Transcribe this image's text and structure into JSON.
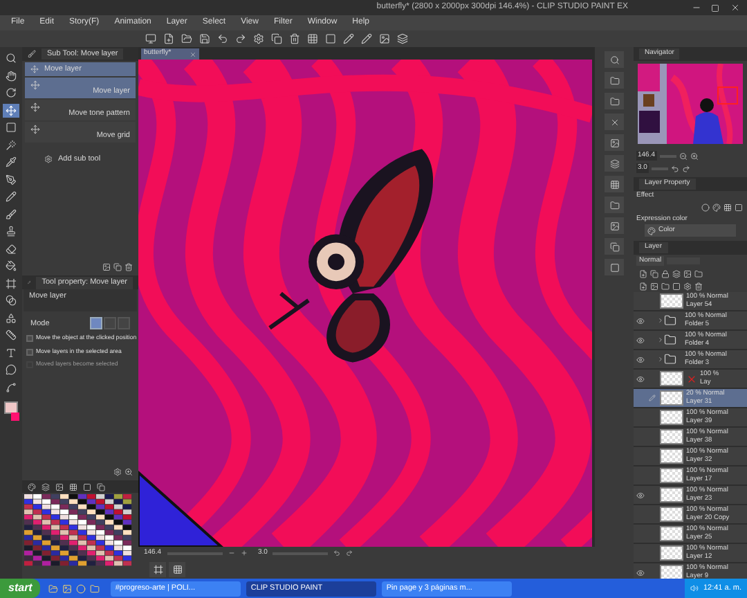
{
  "window": {
    "title": "butterfly* (2800 x 2000px 300dpi 146.4%) - CLIP STUDIO PAINT EX"
  },
  "menu": [
    "File",
    "Edit",
    "Story(F)",
    "Animation",
    "Layer",
    "Select",
    "View",
    "Filter",
    "Window",
    "Help"
  ],
  "tools": [
    {
      "kind": "zoom",
      "selected": false
    },
    {
      "kind": "hand",
      "selected": false
    },
    {
      "kind": "rotate",
      "selected": false
    },
    {
      "kind": "move",
      "selected": true
    },
    {
      "kind": "select",
      "selected": false
    },
    {
      "kind": "wand",
      "selected": false
    },
    {
      "kind": "eyedropper",
      "selected": false
    },
    {
      "kind": "pen",
      "selected": false
    },
    {
      "kind": "pencil",
      "selected": false
    },
    {
      "kind": "brush",
      "selected": false
    },
    {
      "kind": "stamp",
      "selected": false
    },
    {
      "kind": "eraser",
      "selected": false
    },
    {
      "kind": "fill",
      "selected": false
    },
    {
      "kind": "frame",
      "selected": false
    },
    {
      "kind": "gradient",
      "selected": false
    },
    {
      "kind": "shape",
      "selected": false
    },
    {
      "kind": "ruler",
      "selected": false
    },
    {
      "kind": "text",
      "selected": false
    },
    {
      "kind": "balloon",
      "selected": false
    },
    {
      "kind": "line",
      "selected": false
    }
  ],
  "sub_tool": {
    "tab": "Sub Tool: Move layer",
    "group": "Move layer",
    "items": [
      {
        "label": "Move layer",
        "selected": true
      },
      {
        "label": "Move tone pattern",
        "selected": false
      },
      {
        "label": "Move grid",
        "selected": false
      }
    ],
    "add": "Add sub tool"
  },
  "tool_property": {
    "tab": "Tool property: Move layer",
    "name": "Move layer",
    "mode_label": "Mode",
    "modes": [
      {
        "selected": true
      },
      {
        "selected": false
      },
      {
        "selected": false
      }
    ],
    "options": [
      {
        "label": "Move the object at the clicked position",
        "checked": false,
        "disabled": false
      },
      {
        "label": "Move layers in the selected area",
        "checked": false,
        "disabled": false
      },
      {
        "label": "Moved layers become selected",
        "checked": false,
        "disabled": true
      }
    ]
  },
  "document_tab": {
    "title": "butterfly*"
  },
  "canvas_status": {
    "zoom": "146.4",
    "rotation": "3.0"
  },
  "navigator": {
    "tab": "Navigator",
    "zoom": "146.4",
    "rotation": "3.0"
  },
  "layer_property": {
    "tab": "Layer Property",
    "effect_label": "Effect",
    "expression_color_label": "Expression color",
    "expression_color": "Color"
  },
  "layer_panel": {
    "tab": "Layer",
    "blend_mode": "Normal"
  },
  "layers": [
    {
      "kind": "layer",
      "opacity_mode": "100 % Normal",
      "name": "Layer 54",
      "visible": false,
      "selected": false
    },
    {
      "kind": "folder",
      "opacity_mode": "100 % Normal",
      "name": "Folder 5",
      "visible": true,
      "selected": false
    },
    {
      "kind": "folder",
      "opacity_mode": "100 % Normal",
      "name": "Folder 4",
      "visible": true,
      "selected": false
    },
    {
      "kind": "folder",
      "opacity_mode": "100 % Normal",
      "name": "Folder 3",
      "visible": true,
      "selected": false
    },
    {
      "kind": "masked",
      "opacity_mode": "100 %",
      "name": "Lay",
      "visible": true,
      "selected": false
    },
    {
      "kind": "layer",
      "opacity_mode": "20 % Normal",
      "name": "Layer 31",
      "visible": false,
      "selected": true
    },
    {
      "kind": "layer",
      "opacity_mode": "100 % Normal",
      "name": "Layer 39",
      "visible": false,
      "selected": false
    },
    {
      "kind": "layer",
      "opacity_mode": "100 % Normal",
      "name": "Layer 38",
      "visible": false,
      "selected": false
    },
    {
      "kind": "layer",
      "opacity_mode": "100 % Normal",
      "name": "Layer 32",
      "visible": false,
      "selected": false
    },
    {
      "kind": "layer",
      "opacity_mode": "100 % Normal",
      "name": "Layer 17",
      "visible": false,
      "selected": false
    },
    {
      "kind": "layer",
      "opacity_mode": "100 % Normal",
      "name": "Layer 23",
      "visible": true,
      "selected": false
    },
    {
      "kind": "layer",
      "opacity_mode": "100 % Normal",
      "name": "Layer 20 Copy",
      "visible": false,
      "selected": false
    },
    {
      "kind": "layer",
      "opacity_mode": "100 % Normal",
      "name": "Layer 25",
      "visible": false,
      "selected": false
    },
    {
      "kind": "layer",
      "opacity_mode": "100 % Normal",
      "name": "Layer 12",
      "visible": false,
      "selected": false
    },
    {
      "kind": "layer",
      "opacity_mode": "100 % Normal",
      "name": "Layer 9",
      "visible": true,
      "selected": false
    }
  ],
  "taskbar": {
    "start": "start",
    "items": [
      {
        "label": "#progreso-arte | POLI...",
        "selected": false
      },
      {
        "label": "CLIP STUDIO PAINT",
        "selected": true
      },
      {
        "label": "Pin page y 3 páginas m...",
        "selected": false
      }
    ],
    "time": "12:41 a. m."
  }
}
